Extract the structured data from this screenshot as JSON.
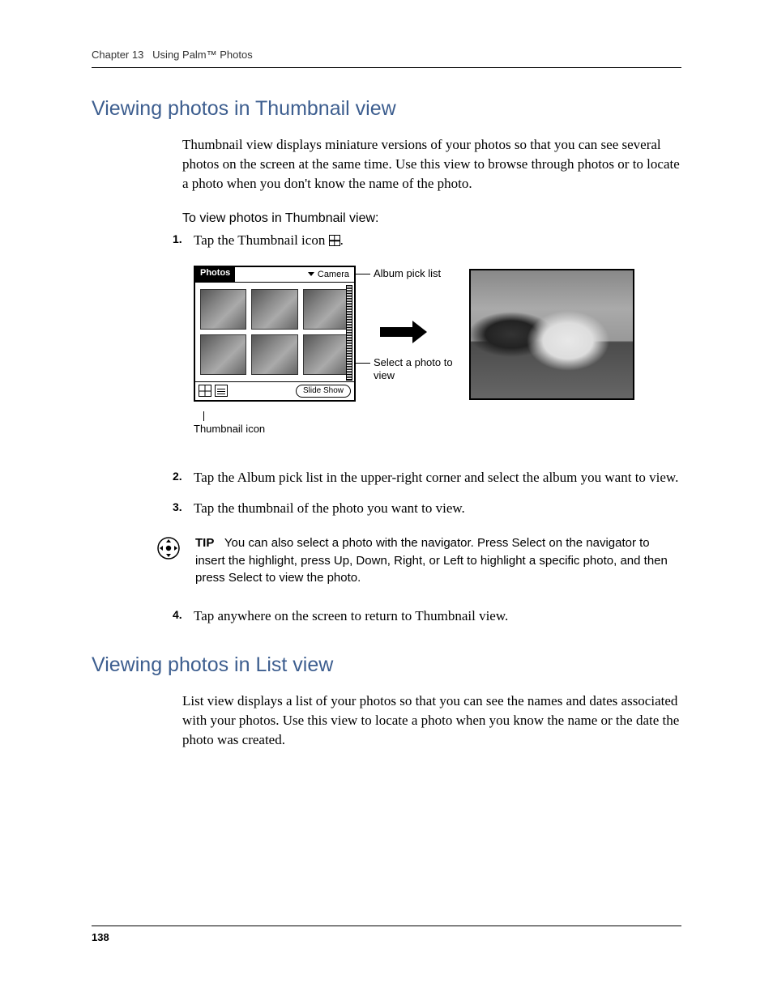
{
  "header": {
    "chapter_label": "Chapter 13",
    "chapter_title": "Using Palm™ Photos"
  },
  "section1": {
    "heading": "Viewing photos in Thumbnail view",
    "intro": "Thumbnail view displays miniature versions of your photos so that you can see several photos on the screen at the same time. Use this view to browse through photos or to locate a photo when you don't know the name of the photo.",
    "subheading": "To view photos in Thumbnail view:",
    "steps": {
      "s1_prefix": "Tap the Thumbnail icon ",
      "s1_suffix": ".",
      "s2": "Tap the Album pick list in the upper-right corner and select the album you want to view.",
      "s3": "Tap the thumbnail of the photo you want to view.",
      "s4": "Tap anywhere on the screen to return to Thumbnail view."
    },
    "tip_label": "TIP",
    "tip_text": "You can also select a photo with the navigator. Press Select on the navigator to insert the highlight, press Up, Down, Right, or Left to highlight a specific photo, and then press Select to view the photo."
  },
  "figure": {
    "app_title": "Photos",
    "picklist_value": "Camera",
    "slideshow_label": "Slide Show",
    "callout_album": "Album pick list",
    "callout_select": "Select a photo to view",
    "thumbnail_caption": "Thumbnail icon"
  },
  "section2": {
    "heading": "Viewing photos in List view",
    "intro": "List view displays a list of your photos so that you can see the names and dates associated with your photos. Use this view to locate a photo when you know the name or the date the photo was created."
  },
  "page_number": "138"
}
